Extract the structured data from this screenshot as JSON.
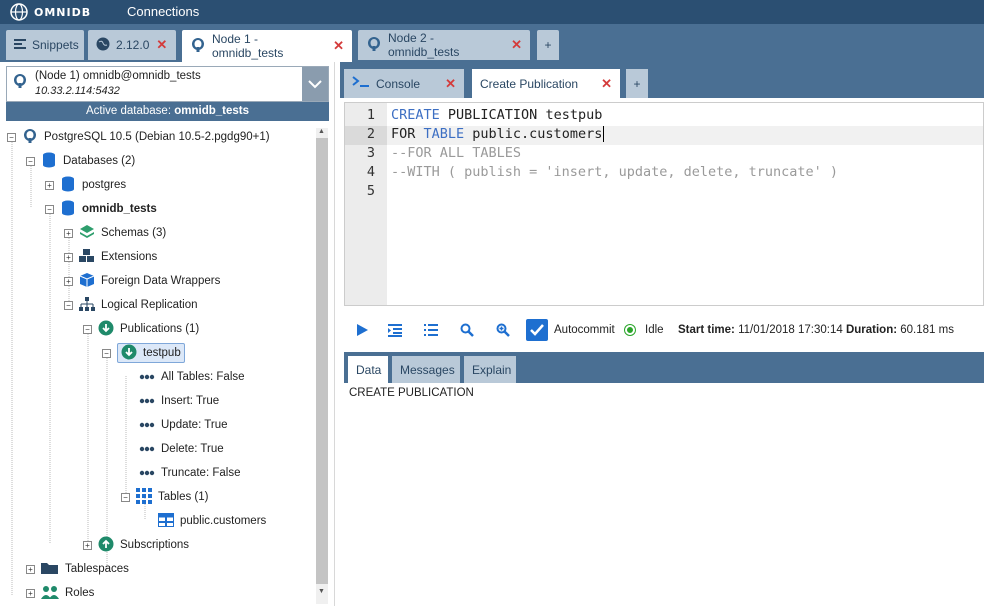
{
  "topbar": {
    "logo_text": "OMNIDB",
    "connections_label": "Connections"
  },
  "tabs": [
    {
      "label": "Snippets",
      "icon": "snippets-icon"
    },
    {
      "label": "2.12.0",
      "icon": "globe-icon"
    },
    {
      "label": "Node 1 - omnidb_tests",
      "icon": "postgresql-icon"
    },
    {
      "label": "Node 2 - omnidb_tests",
      "icon": "postgresql-icon"
    },
    {
      "label": "+"
    }
  ],
  "connection": {
    "title": "(Node 1) omnidb@omnidb_tests",
    "host": "10.33.2.114:5432"
  },
  "active_db": {
    "prefix": "Active database:",
    "name": "omnidb_tests"
  },
  "tree": {
    "server": "PostgreSQL 10.5 (Debian 10.5-2.pgdg90+1)",
    "databases": "Databases (2)",
    "db_postgres": "postgres",
    "db_omnidb": "omnidb_tests",
    "schemas": "Schemas (3)",
    "extensions": "Extensions",
    "fdw": "Foreign Data Wrappers",
    "logical_replication": "Logical Replication",
    "publications": "Publications (1)",
    "testpub": "testpub",
    "all_tables": "All Tables: False",
    "insert": "Insert: True",
    "update": "Update: True",
    "delete": "Delete: True",
    "truncate": "Truncate: False",
    "tables": "Tables (1)",
    "customers": "public.customers",
    "subscriptions": "Subscriptions",
    "tablespaces": "Tablespaces",
    "roles": "Roles"
  },
  "right_tabs": [
    {
      "label": "Console",
      "icon": "console-icon"
    },
    {
      "label": "Create Publication"
    },
    {
      "label": "+"
    }
  ],
  "editor": {
    "line_numbers": [
      "1",
      "2",
      "3",
      "4",
      "5"
    ],
    "line1_kw": "CREATE",
    "line1_rest": " PUBLICATION testpub",
    "line2_a": "FOR ",
    "line2_kw": "TABLE",
    "line2_rest": " public.customers",
    "line3": "--FOR ALL TABLES",
    "line4": "--WITH ( publish = 'insert, update, delete, truncate' )"
  },
  "toolbar": {
    "autocommit": "Autocommit",
    "status": "Idle",
    "start_label": "Start time:",
    "start_value": "11/01/2018 17:30:14",
    "duration_label": "Duration:",
    "duration_value": "60.181 ms"
  },
  "result_tabs": [
    "Data",
    "Messages",
    "Explain"
  ],
  "result_text": "CREATE PUBLICATION",
  "colors": {
    "header": "#2b4f72",
    "tabbar": "#4a6f93",
    "keyword": "#3d6fc3",
    "close": "#d43b3b"
  }
}
